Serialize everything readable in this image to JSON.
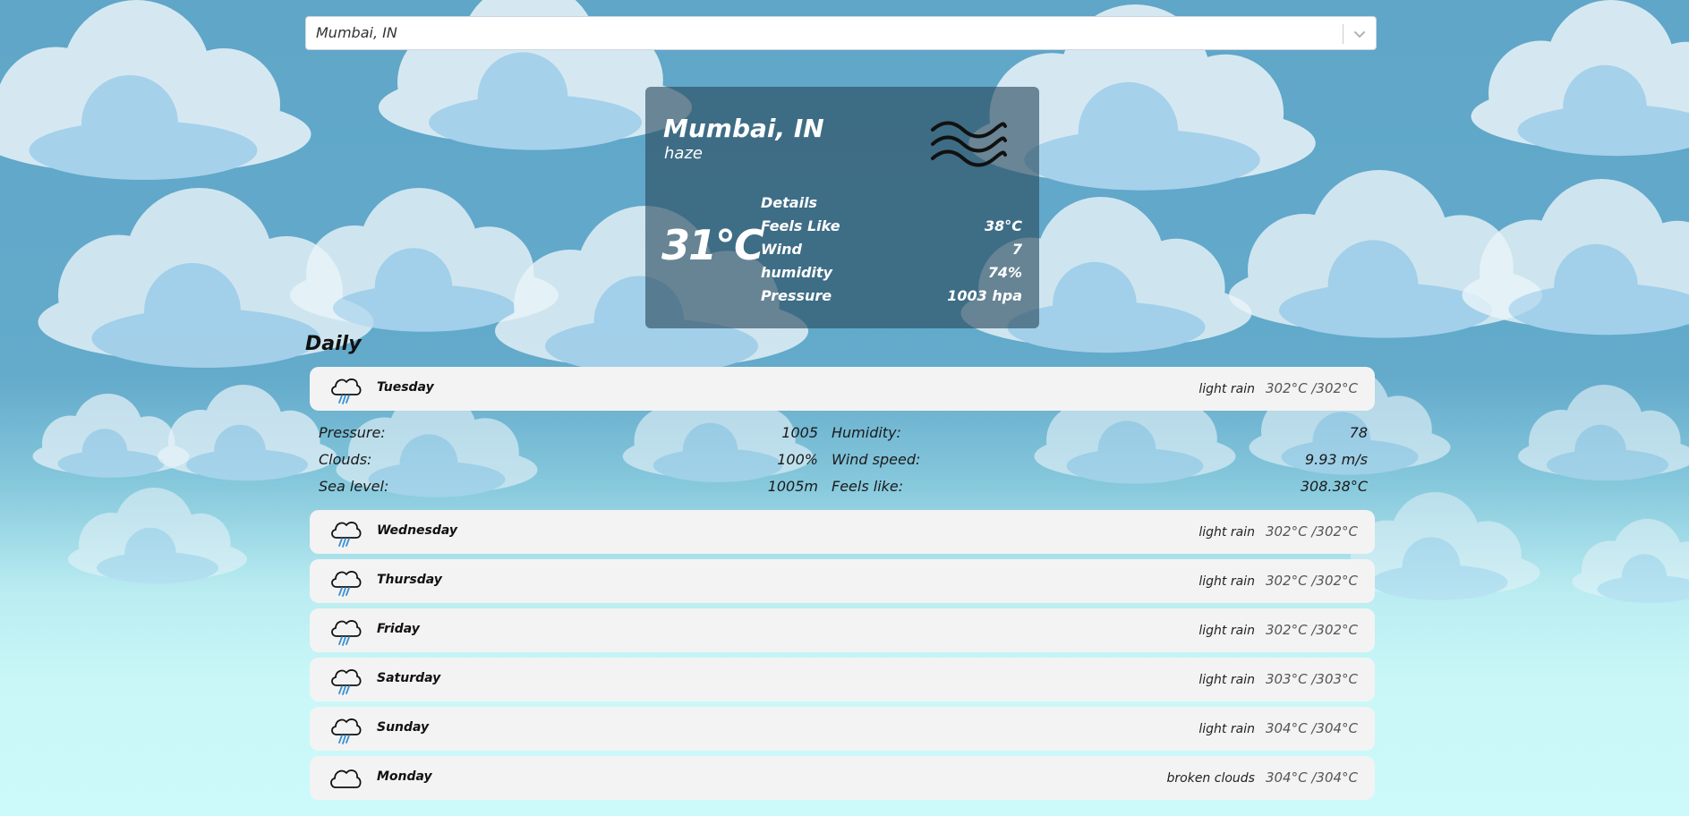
{
  "search": {
    "value": "Mumbai, IN"
  },
  "current": {
    "city": "Mumbai, IN",
    "description": "haze",
    "temperature": "31°C",
    "details_heading": "Details",
    "details": [
      {
        "label": "Feels Like",
        "value": "38°C"
      },
      {
        "label": "Wind",
        "value": "7"
      },
      {
        "label": "humidity",
        "value": "74%"
      },
      {
        "label": "Pressure",
        "value": "1003 hpa"
      }
    ],
    "icon": "haze-icon"
  },
  "daily": {
    "heading": "Daily",
    "days": [
      {
        "name": "Tuesday",
        "description": "light rain",
        "temps": "302°C /302°C",
        "icon": "rain-cloud-icon"
      },
      {
        "name": "Wednesday",
        "description": "light rain",
        "temps": "302°C /302°C",
        "icon": "rain-cloud-icon"
      },
      {
        "name": "Thursday",
        "description": "light rain",
        "temps": "302°C /302°C",
        "icon": "rain-cloud-icon"
      },
      {
        "name": "Friday",
        "description": "light rain",
        "temps": "302°C /302°C",
        "icon": "rain-cloud-icon"
      },
      {
        "name": "Saturday",
        "description": "light rain",
        "temps": "303°C /303°C",
        "icon": "rain-cloud-icon"
      },
      {
        "name": "Sunday",
        "description": "light rain",
        "temps": "304°C /304°C",
        "icon": "rain-cloud-icon"
      },
      {
        "name": "Monday",
        "description": "broken clouds",
        "temps": "304°C /304°C",
        "icon": "cloud-icon"
      }
    ],
    "expanded": {
      "pressure_label": "Pressure:",
      "pressure_value": "1005",
      "humidity_label": "Humidity:",
      "humidity_value": "78",
      "clouds_label": "Clouds:",
      "clouds_value": "100%",
      "wind_label": "Wind speed:",
      "wind_value": "9.93 m/s",
      "sea_label": "Sea level:",
      "sea_value": "1005m",
      "feels_label": "Feels like:",
      "feels_value": "308.38°C"
    }
  },
  "colors": {
    "sky_top": "#5fa6c8",
    "sky_bottom": "#ccfafa",
    "cloud": "#eaf4f9",
    "cloud_shade": "#b3d9f1",
    "card": "#28485c",
    "row": "#f3f3f3",
    "rain": "#3c8fd0"
  }
}
